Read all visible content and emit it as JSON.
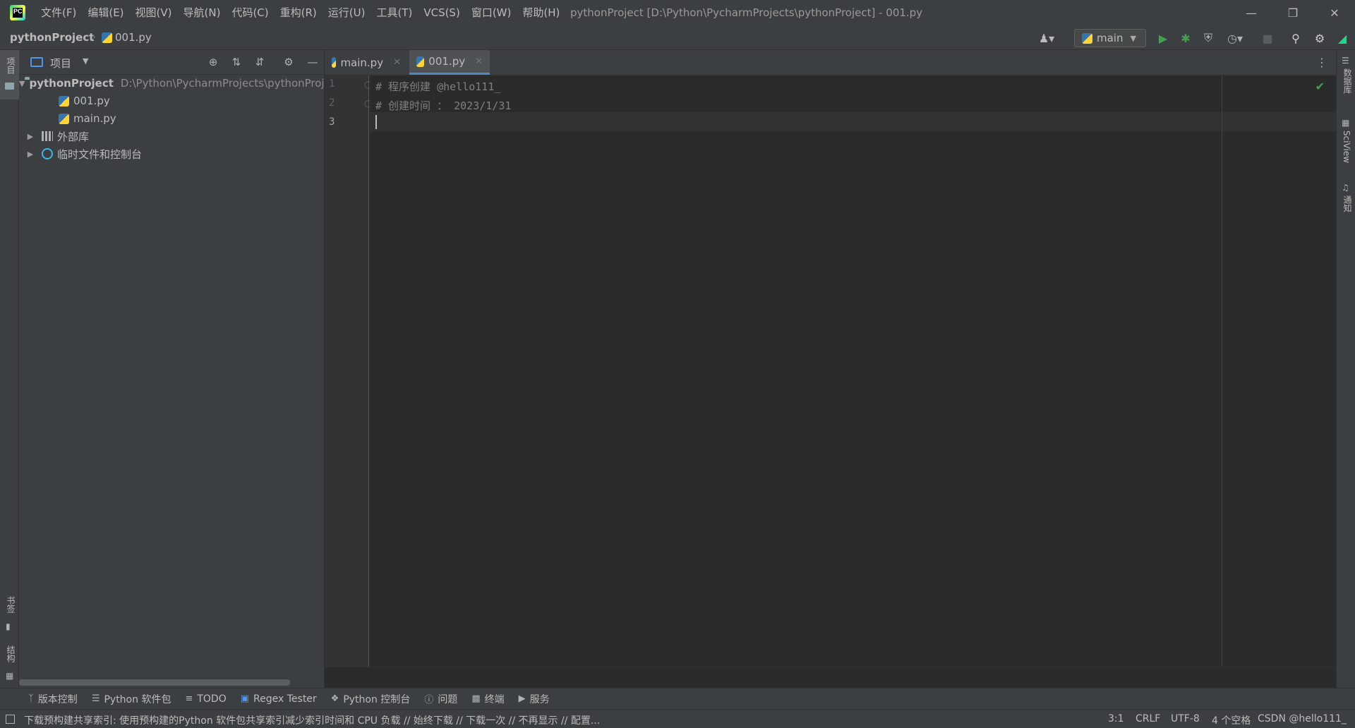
{
  "titlebar": {
    "menus": [
      "文件(F)",
      "编辑(E)",
      "视图(V)",
      "导航(N)",
      "代码(C)",
      "重构(R)",
      "运行(U)",
      "工具(T)",
      "VCS(S)",
      "窗口(W)",
      "帮助(H)"
    ],
    "window_title": "pythonProject [D:\\Python\\PycharmProjects\\pythonProject] - 001.py"
  },
  "navbar": {
    "project": "pythonProject",
    "file": "001.py",
    "run_config": "main"
  },
  "left_strip": {
    "project_label": "项目",
    "bookmarks_label": "书签",
    "structure_label": "结构"
  },
  "right_strip": {
    "database_label": "数据库",
    "sciview_label": "SciView",
    "notifications_label": "通知"
  },
  "project_panel": {
    "title": "项目",
    "root_name": "pythonProject",
    "root_path": "D:\\Python\\PycharmProjects\\pythonProject",
    "files": [
      "001.py",
      "main.py"
    ],
    "external_libs": "外部库",
    "scratches": "临时文件和控制台"
  },
  "editor": {
    "tabs": [
      {
        "label": "main.py",
        "active": false
      },
      {
        "label": "001.py",
        "active": true
      }
    ],
    "line_numbers": [
      "1",
      "2",
      "3"
    ],
    "lines": [
      "# 程序创建 @hello111_",
      "# 创建时间 ： 2023/1/31",
      ""
    ]
  },
  "tool_windows": [
    {
      "icon": "branch-icon",
      "label": "版本控制"
    },
    {
      "icon": "layers-icon",
      "label": "Python 软件包"
    },
    {
      "icon": "list-icon",
      "label": "TODO"
    },
    {
      "icon": "regex-icon",
      "label": "Regex Tester"
    },
    {
      "icon": "python-console-icon",
      "label": "Python 控制台"
    },
    {
      "icon": "info-icon",
      "label": "问题"
    },
    {
      "icon": "terminal-icon",
      "label": "终端"
    },
    {
      "icon": "services-icon",
      "label": "服务"
    }
  ],
  "statusbar": {
    "message": "下载预构建共享索引: 使用预构建的Python 软件包共享索引减少索引时间和 CPU 负载 // 始终下载 // 下载一次 // 不再显示 // 配置...",
    "position": "3:1",
    "line_sep": "CRLF",
    "encoding": "UTF-8",
    "indent": "4 个空格",
    "interpreter": "CSDN @hello111_"
  }
}
